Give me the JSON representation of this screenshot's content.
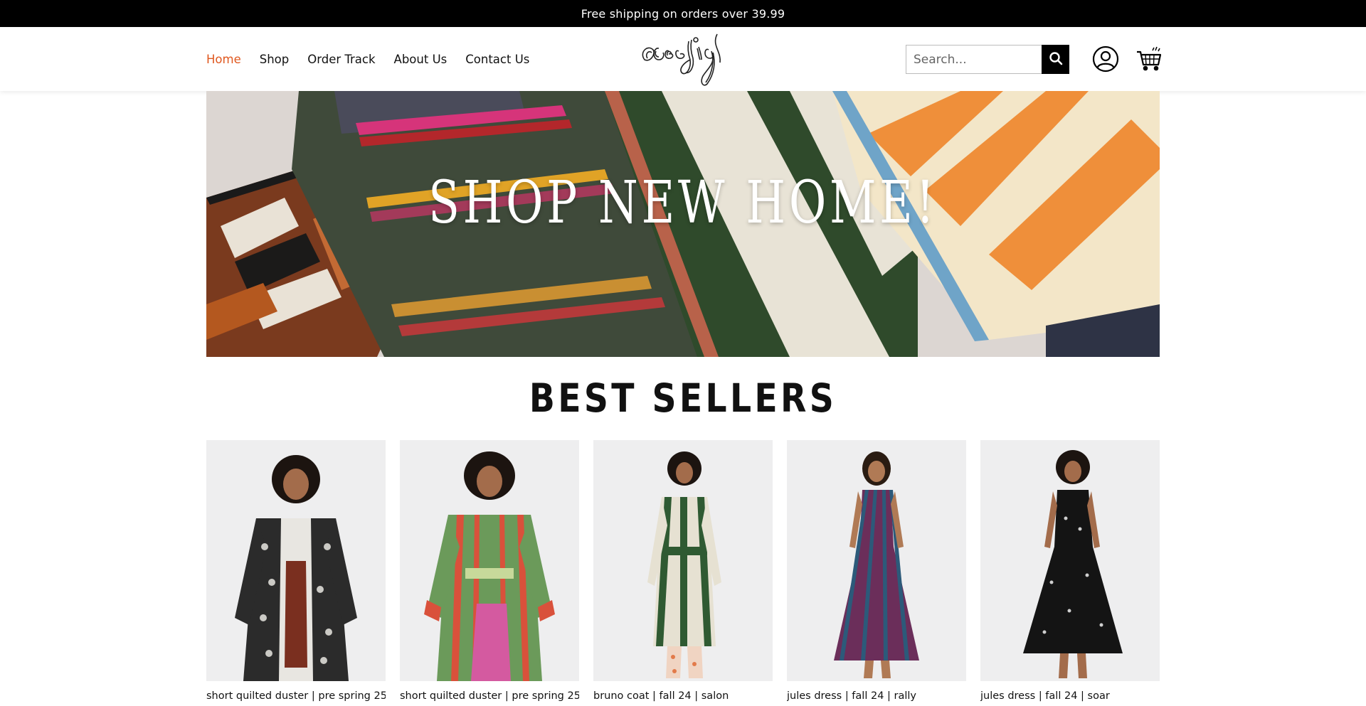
{
  "announcement": {
    "text": "Free shipping on orders over 39.99"
  },
  "nav": {
    "items": [
      {
        "label": "Home",
        "active": true
      },
      {
        "label": "Shop"
      },
      {
        "label": "Order Track"
      },
      {
        "label": "About Us"
      },
      {
        "label": "Contact Us"
      }
    ]
  },
  "brand": {
    "logo_text": "aceejig"
  },
  "search": {
    "placeholder": "Search...",
    "icon": "search-icon"
  },
  "header_icons": {
    "account": "account-icon",
    "cart": "cart-icon"
  },
  "hero": {
    "title": "SHOP NEW HOME!"
  },
  "best_sellers": {
    "title": "BEST SELLERS",
    "products": [
      {
        "name": "short quilted duster | pre spring 25"
      },
      {
        "name": "short quilted duster | pre spring 25"
      },
      {
        "name": "bruno coat | fall 24 | salon"
      },
      {
        "name": "jules dress | fall 24 | rally"
      },
      {
        "name": "jules dress | fall 24 | soar"
      }
    ]
  },
  "colors": {
    "accent": "#e0581f",
    "announcement_bg": "#000000",
    "text": "#111111"
  }
}
